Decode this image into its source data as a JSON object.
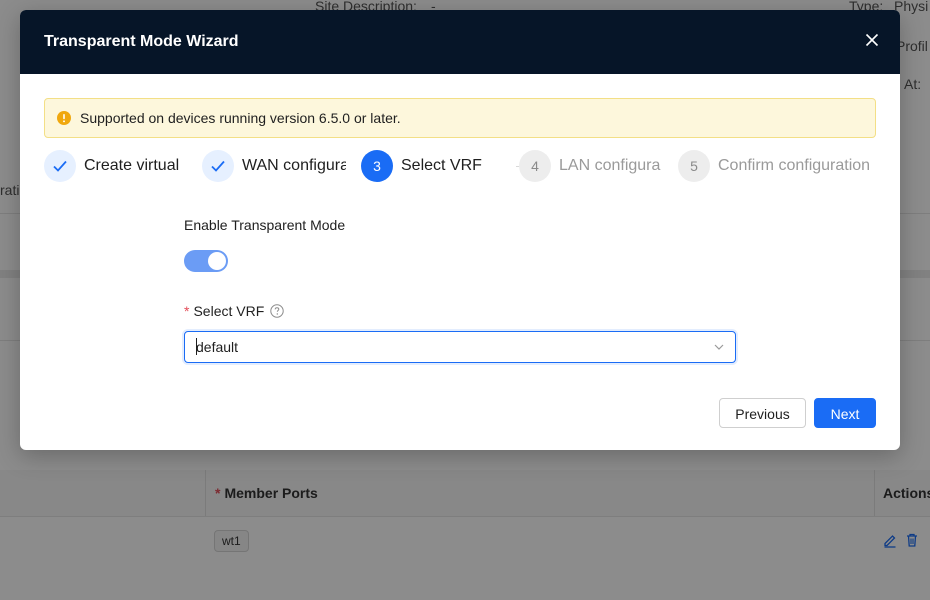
{
  "background": {
    "site_description_label": "Site Description:",
    "site_description_value": "-",
    "type_label": "Type:",
    "type_value": "Physi",
    "profile_label": "Profil",
    "at_label": "At:",
    "left_fragment": "rati",
    "table": {
      "member_ports_header": "Member Ports",
      "actions_header": "Actions",
      "rows": [
        {
          "port_tag": "wt1"
        }
      ]
    }
  },
  "modal": {
    "title": "Transparent Mode Wizard",
    "alert_text": "Supported on devices running version 6.5.0 or later.",
    "steps": [
      {
        "number": "1",
        "label": "Create virtual",
        "status": "done"
      },
      {
        "number": "2",
        "label": "WAN configura",
        "status": "done"
      },
      {
        "number": "3",
        "label": "Select VRF",
        "status": "active"
      },
      {
        "number": "4",
        "label": "LAN configura",
        "status": "pending"
      },
      {
        "number": "5",
        "label": "Confirm configuration",
        "status": "pending"
      }
    ],
    "enable_label": "Enable Transparent Mode",
    "enable_value": true,
    "vrf_label": "Select VRF",
    "vrf_value": "default",
    "previous_label": "Previous",
    "next_label": "Next"
  },
  "colors": {
    "header_bg": "#061528",
    "primary": "#1a6cf5",
    "alert_bg": "#fdf7dc",
    "alert_icon": "#f0a80e",
    "required": "#e34d59"
  },
  "icons": {
    "close": "close-icon",
    "alert": "warning-circle-icon",
    "check": "check-icon",
    "help": "question-circle-icon",
    "dropdown": "chevron-down-icon",
    "edit": "edit-icon",
    "delete": "trash-icon"
  }
}
